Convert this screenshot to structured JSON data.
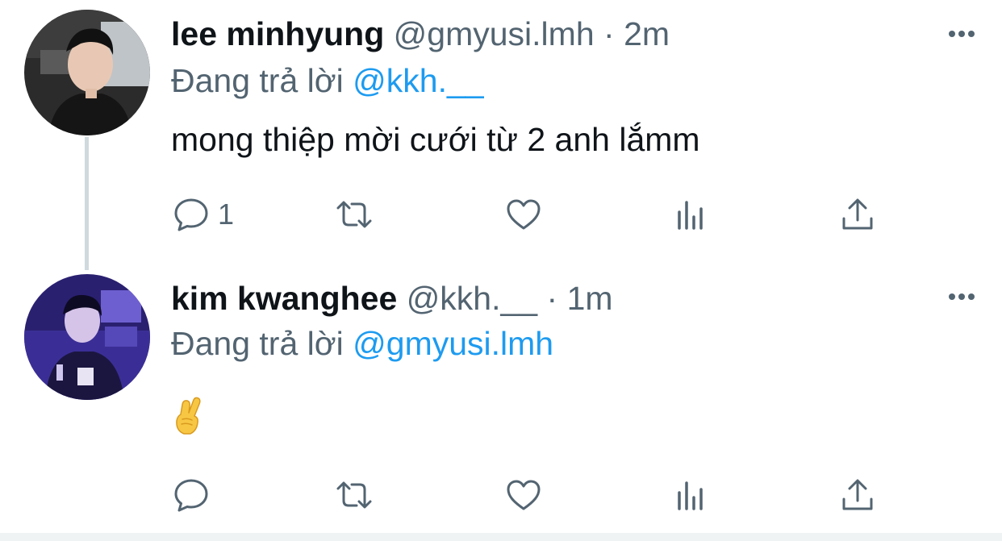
{
  "tweets": [
    {
      "author": "lee minhyung",
      "handle": "@gmyusi.lmh",
      "separator": "·",
      "time": "2m",
      "reply_prefix": "Đang trả lời",
      "reply_to": "@kkh.__",
      "text": "mong thiệp mời cưới từ 2 anh lắmm",
      "reply_count": "1"
    },
    {
      "author": "kim kwanghee",
      "handle": "@kkh.__",
      "separator": "·",
      "time": "1m",
      "reply_prefix": "Đang trả lời",
      "reply_to": "@gmyusi.lmh",
      "text": "",
      "emoji": "crossed-fingers-emoji",
      "reply_count": ""
    }
  ],
  "icons": {
    "reply": "comment-icon",
    "retweet": "retweet-icon",
    "like": "heart-icon",
    "views": "views-chart-icon",
    "share": "share-icon",
    "more": "more-dots-icon"
  },
  "colors": {
    "text": "#0f1419",
    "muted": "#536471",
    "link": "#1d9bf0",
    "thread_line": "#cfd9de"
  }
}
